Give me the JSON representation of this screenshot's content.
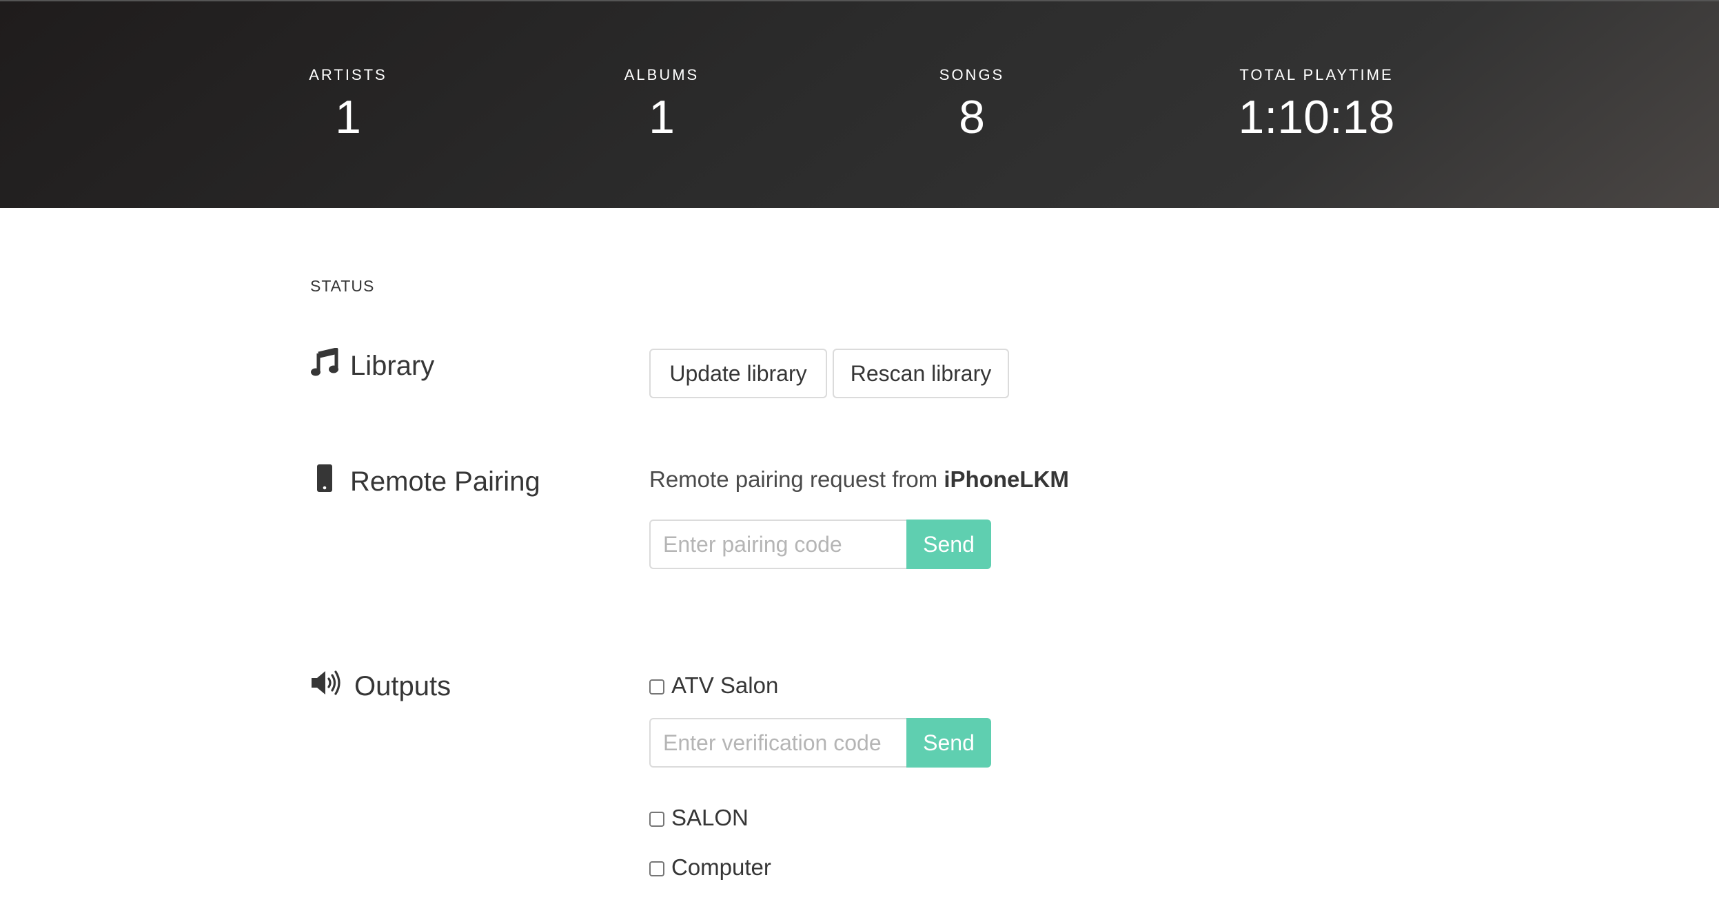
{
  "stats": {
    "artists": {
      "label": "Artists",
      "value": "1"
    },
    "albums": {
      "label": "Albums",
      "value": "1"
    },
    "songs": {
      "label": "Songs",
      "value": "8"
    },
    "playtime": {
      "label": "Total playtime",
      "value": "1:10:18"
    }
  },
  "status": {
    "title": "Status"
  },
  "library": {
    "label": "Library",
    "icon": "music-note-icon",
    "update_button": "Update library",
    "rescan_button": "Rescan library"
  },
  "pairing": {
    "label": "Remote Pairing",
    "icon": "mobile-phone-icon",
    "request_text": "Remote pairing request from",
    "device_name": "iPhoneLKM",
    "input_placeholder": "Enter pairing code",
    "send_label": "Send"
  },
  "outputs": {
    "label": "Outputs",
    "icon": "speaker-volume-icon",
    "items": [
      {
        "name": "ATV Salon",
        "checked": false
      },
      {
        "name": "SALON",
        "checked": false
      },
      {
        "name": "Computer",
        "checked": false
      }
    ],
    "verification_placeholder": "Enter verification code",
    "send_label": "Send"
  },
  "colors": {
    "accent": "#5fcfb0",
    "hero_dark": "#1f1c1c",
    "text": "#363636"
  }
}
